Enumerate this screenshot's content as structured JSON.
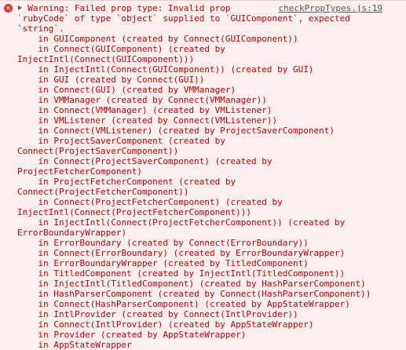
{
  "entry": {
    "level_icon": "error-icon",
    "source_link": "checkPropTypes.js:19",
    "lines": [
      "  Warning: Failed prop type: Invalid prop",
      "`rubyCode` of type `object` supplied to `GUIComponent`, expected",
      "`string`.",
      "    in GUIComponent (created by Connect(GUIComponent))",
      "    in Connect(GUIComponent) (created by",
      "InjectIntl(Connect(GUIComponent)))",
      "    in InjectIntl(Connect(GUIComponent)) (created by GUI)",
      "    in GUI (created by Connect(GUI))",
      "    in Connect(GUI) (created by VMManager)",
      "    in VMManager (created by Connect(VMManager))",
      "    in Connect(VMManager) (created by VMListener)",
      "    in VMListener (created by Connect(VMListener))",
      "    in Connect(VMListener) (created by ProjectSaverComponent)",
      "    in ProjectSaverComponent (created by",
      "Connect(ProjectSaverComponent))",
      "    in Connect(ProjectSaverComponent) (created by",
      "ProjectFetcherComponent)",
      "    in ProjectFetcherComponent (created by",
      "Connect(ProjectFetcherComponent))",
      "    in Connect(ProjectFetcherComponent) (created by",
      "InjectIntl(Connect(ProjectFetcherComponent)))",
      "    in InjectIntl(Connect(ProjectFetcherComponent)) (created by",
      "ErrorBoundaryWrapper)",
      "    in ErrorBoundary (created by Connect(ErrorBoundary))",
      "    in Connect(ErrorBoundary) (created by ErrorBoundaryWrapper)",
      "    in ErrorBoundaryWrapper (created by TitledComponent)",
      "    in TitledComponent (created by InjectIntl(TitledComponent))",
      "    in InjectIntl(TitledComponent) (created by HashParserComponent)",
      "    in HashParserComponent (created by Connect(HashParserComponent))",
      "    in Connect(HashParserComponent) (created by AppStateWrapper)",
      "    in IntlProvider (created by Connect(IntlProvider))",
      "    in Connect(IntlProvider) (created by AppStateWrapper)",
      "    in Provider (created by AppStateWrapper)",
      "    in AppStateWrapper"
    ]
  },
  "colors": {
    "background": "#fef0ef",
    "text": "#c80000",
    "icon": "#e8332b",
    "link": "#5a5a5a"
  }
}
